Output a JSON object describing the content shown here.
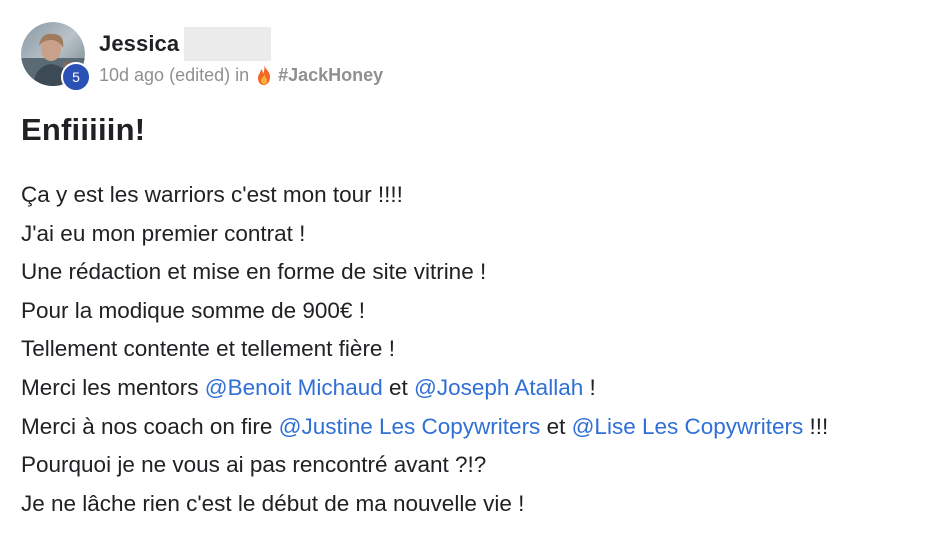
{
  "author": {
    "name": "Jessica",
    "level": "5"
  },
  "meta": {
    "time": "10d ago",
    "edited": "(edited)",
    "in_word": "in",
    "channel_icon": "fire-icon",
    "channel": "#JackHoney"
  },
  "post": {
    "title": "Enfiiiiin!",
    "lines": {
      "l1": "Ça y est les warriors c'est mon tour !!!!",
      "l2": "J'ai eu mon premier contrat !",
      "l3": "Une rédaction et mise en forme de site vitrine !",
      "l4": "Pour la modique somme de 900€ !",
      "l5": "Tellement contente et tellement fière !",
      "l6_a": "Merci les mentors ",
      "l6_m1": "@Benoit Michaud",
      "l6_b": " et ",
      "l6_m2": "@Joseph Atallah",
      "l6_c": " !",
      "l7_a": "Merci à nos coach on fire ",
      "l7_m1": "@Justine Les Copywriters",
      "l7_b": " et ",
      "l7_m2": "@Lise Les Copywriters",
      "l7_c": " !!!",
      "l8": "Pourquoi je ne vous ai pas rencontré avant ?!?",
      "l9": "Je ne lâche rien c'est le début de ma nouvelle vie !"
    }
  },
  "colors": {
    "mention": "#2f6fd6",
    "badge": "#2c51b5",
    "meta_text": "#909090",
    "text": "#202124"
  }
}
